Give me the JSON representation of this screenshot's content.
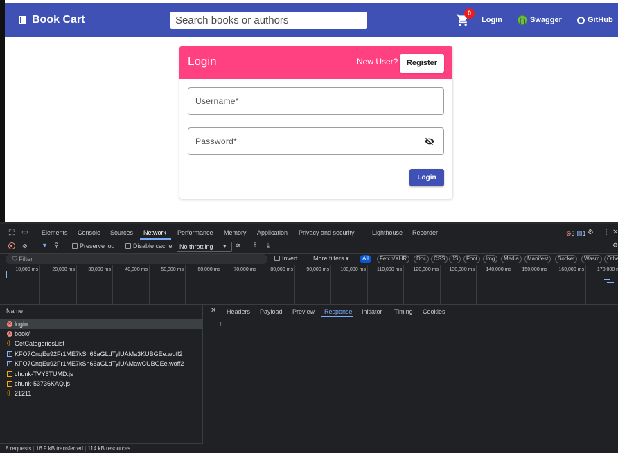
{
  "app": {
    "brand": "Book Cart",
    "search_placeholder": "Search books or authors",
    "cart_count": "0",
    "nav": {
      "login": "Login",
      "swagger": "Swagger",
      "github": "GitHub"
    },
    "colors": {
      "primary": "#3f51b5",
      "accent": "#ff4081"
    }
  },
  "login_card": {
    "title": "Login",
    "new_user": "New User?",
    "register": "Register",
    "username_label": "Username*",
    "password_label": "Password*",
    "submit": "Login"
  },
  "devtools": {
    "tabs": [
      "Elements",
      "Console",
      "Sources",
      "Network",
      "Performance",
      "Memory",
      "Application",
      "Privacy and security",
      "Lighthouse",
      "Recorder"
    ],
    "active_tab": "Network",
    "error_count": "3",
    "message_count": "1",
    "toolbar": {
      "preserve_log": "Preserve log",
      "disable_cache": "Disable cache",
      "throttling": "No throttling"
    },
    "filter": {
      "placeholder": "Filter",
      "invert": "Invert",
      "more_filters": "More filters",
      "types": [
        "All",
        "Fetch/XHR",
        "Doc",
        "CSS",
        "JS",
        "Font",
        "Img",
        "Media",
        "Manifest",
        "Socket",
        "Wasm",
        "Othe"
      ]
    },
    "timeline_ticks": [
      "10,000 ms",
      "20,000 ms",
      "30,000 ms",
      "40,000 ms",
      "50,000 ms",
      "60,000 ms",
      "70,000 ms",
      "80,000 ms",
      "90,000 ms",
      "100,000 ms",
      "110,000 ms",
      "120,000 ms",
      "130,000 ms",
      "140,000 ms",
      "150,000 ms",
      "160,000 ms",
      "170,000 m"
    ],
    "name_header": "Name",
    "requests": [
      {
        "name": "login",
        "type": "error"
      },
      {
        "name": "book/",
        "type": "error"
      },
      {
        "name": "GetCategoriesList",
        "type": "xhr"
      },
      {
        "name": "KFO7CnqEu92Fr1ME7kSn66aGLdTylUAMa3KUBGEe.woff2",
        "type": "font"
      },
      {
        "name": "KFO7CnqEu92Fr1ME7kSn66aGLdTylUAMawCUBGEe.woff2",
        "type": "font"
      },
      {
        "name": "chunk-TVY5TUMD.js",
        "type": "js"
      },
      {
        "name": "chunk-53736KAQ.js",
        "type": "js"
      },
      {
        "name": "21211",
        "type": "xhr"
      }
    ],
    "detail_tabs": [
      "Headers",
      "Payload",
      "Preview",
      "Response",
      "Initiator",
      "Timing",
      "Cookies"
    ],
    "active_detail_tab": "Response",
    "response_line": "1",
    "status": {
      "requests": "8 requests",
      "transferred": "16.9 kB transferred",
      "resources": "114 kB resources"
    }
  }
}
